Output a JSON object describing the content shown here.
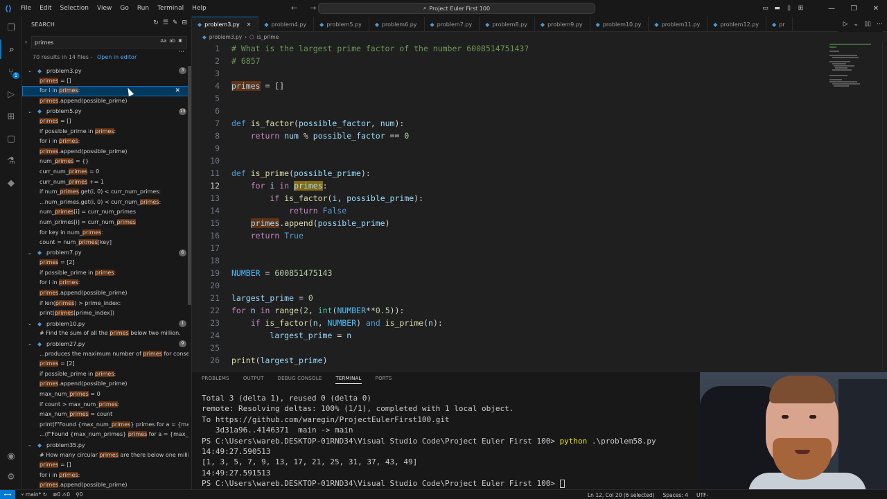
{
  "titlebar": {
    "menu": [
      "File",
      "Edit",
      "Selection",
      "View",
      "Go",
      "Run",
      "Terminal",
      "Help"
    ],
    "search_text": "Project Euler First 100"
  },
  "sidebar": {
    "header": "SEARCH",
    "search_value": "primes",
    "opt_case": "Aa",
    "opt_word": "ab",
    "summary": "70 results in 14 files -",
    "open_in_editor": "Open in editor",
    "results": [
      {
        "type": "file",
        "name": "problem3.py",
        "count": "3"
      },
      {
        "type": "line",
        "pre": "",
        "hl": "primes",
        "post": " = []"
      },
      {
        "type": "line",
        "pre": "for i in ",
        "hl": "primes",
        "post": ":",
        "selected": true
      },
      {
        "type": "line",
        "pre": "",
        "hl": "primes",
        "post": ".append(possible_prime)"
      },
      {
        "type": "file",
        "name": "problem5.py",
        "count": "13"
      },
      {
        "type": "line",
        "pre": "",
        "hl": "primes",
        "post": " = []"
      },
      {
        "type": "line",
        "pre": "if possible_prime in ",
        "hl": "primes",
        "post": ":"
      },
      {
        "type": "line",
        "pre": "for i in ",
        "hl": "primes",
        "post": ":"
      },
      {
        "type": "line",
        "pre": "",
        "hl": "primes",
        "post": ".append(possible_prime)"
      },
      {
        "type": "line",
        "pre": "num_",
        "hl": "primes",
        "post": " = {}"
      },
      {
        "type": "line",
        "pre": "curr_num_",
        "hl": "primes",
        "post": " = 0"
      },
      {
        "type": "line",
        "pre": "curr_num_",
        "hl": "primes",
        "post": " += 1"
      },
      {
        "type": "line",
        "pre": "if num_",
        "hl": "primes",
        "post": ".get(i, 0) < curr_num_primes:"
      },
      {
        "type": "line",
        "pre": "...num_primes.get(i, 0) < curr_num_",
        "hl": "primes",
        "post": ":"
      },
      {
        "type": "line",
        "pre": "num_",
        "hl": "primes",
        "post": "[i] = curr_num_primes"
      },
      {
        "type": "line",
        "pre": "num_primes[i] = curr_num_",
        "hl": "primes",
        "post": ""
      },
      {
        "type": "line",
        "pre": "for key in num_",
        "hl": "primes",
        "post": ":"
      },
      {
        "type": "line",
        "pre": "count = num_",
        "hl": "primes",
        "post": "[key]"
      },
      {
        "type": "file",
        "name": "problem7.py",
        "count": "6"
      },
      {
        "type": "line",
        "pre": "",
        "hl": "primes",
        "post": " = [2]"
      },
      {
        "type": "line",
        "pre": "if possible_prime in ",
        "hl": "primes",
        "post": ":"
      },
      {
        "type": "line",
        "pre": "for i in ",
        "hl": "primes",
        "post": ":"
      },
      {
        "type": "line",
        "pre": "",
        "hl": "primes",
        "post": ".append(possible_prime)"
      },
      {
        "type": "line",
        "pre": "if len(",
        "hl": "primes",
        "post": ") > prime_index:"
      },
      {
        "type": "line",
        "pre": "print(",
        "hl": "primes",
        "post": "[prime_index])"
      },
      {
        "type": "file",
        "name": "problem10.py",
        "count": "1"
      },
      {
        "type": "line",
        "pre": "# Find the sum of all the ",
        "hl": "primes",
        "post": " below two million."
      },
      {
        "type": "file",
        "name": "problem27.py",
        "count": "9"
      },
      {
        "type": "line",
        "pre": "...produces the maximum number of ",
        "hl": "primes",
        "post": " for consec..."
      },
      {
        "type": "line",
        "pre": "",
        "hl": "primes",
        "post": " = [2]"
      },
      {
        "type": "line",
        "pre": "if possible_prime in ",
        "hl": "primes",
        "post": ":"
      },
      {
        "type": "line",
        "pre": "",
        "hl": "primes",
        "post": ".append(possible_prime)"
      },
      {
        "type": "line",
        "pre": "max_num_",
        "hl": "primes",
        "post": " = 0"
      },
      {
        "type": "line",
        "pre": "if count > max_num_",
        "hl": "primes",
        "post": ":"
      },
      {
        "type": "line",
        "pre": "max_num_",
        "hl": "primes",
        "post": " = count"
      },
      {
        "type": "line",
        "pre": "print(f\"Found {max_num_",
        "hl": "primes",
        "post": "} primes for a = {max_a..."
      },
      {
        "type": "line",
        "pre": "...(f\"Found {max_num_primes} ",
        "hl": "primes",
        "post": " for a = {max_a_b[..."
      },
      {
        "type": "file",
        "name": "problem35.py",
        "count": ""
      },
      {
        "type": "line",
        "pre": "# How many circular ",
        "hl": "primes",
        "post": " are there below one million?"
      },
      {
        "type": "line",
        "pre": "",
        "hl": "primes",
        "post": " = []"
      },
      {
        "type": "line",
        "pre": "for i in ",
        "hl": "primes",
        "post": ":"
      },
      {
        "type": "line",
        "pre": "",
        "hl": "primes",
        "post": ".append(possible_prime)"
      }
    ]
  },
  "editor": {
    "tabs": [
      "problem3.py",
      "problem4.py",
      "problem5.py",
      "problem6.py",
      "problem7.py",
      "problem8.py",
      "problem9.py",
      "problem10.py",
      "problem11.py",
      "problem12.py",
      "pr"
    ],
    "active_tab": "problem3.py",
    "breadcrumb_file": "problem3.py",
    "breadcrumb_symbol": "is_prime",
    "current_line": "12"
  },
  "panel": {
    "tabs": [
      "PROBLEMS",
      "OUTPUT",
      "DEBUG CONSOLE",
      "TERMINAL",
      "PORTS"
    ],
    "active_tab": "TERMINAL",
    "terminal": [
      "Total 3 (delta 1), reused 0 (delta 0)",
      "remote: Resolving deltas: 100% (1/1), completed with 1 local object.",
      "To https://github.com/waregin/ProjectEulerFirst100.git",
      "   3d31a96..4146371  main -> main",
      "14:49:27.590513",
      "[1, 3, 5, 7, 9, 13, 17, 21, 25, 31, 37, 43, 49]",
      "14:49:27.591513"
    ],
    "prompt_path": "PS C:\\Users\\wareb.DESKTOP-01RND34\\Visual Studio Code\\Project Euler First 100> ",
    "prompt_cmd": "python",
    "prompt_arg": " .\\problem58.py",
    "final_prompt": "PS C:\\Users\\wareb.DESKTOP-01RND34\\Visual Studio Code\\Project Euler First 100> "
  },
  "statusbar": {
    "branch": "main*",
    "errors": "0",
    "warnings": "0",
    "ports": "0",
    "position": "Ln 12, Col 20 (6 selected)",
    "spaces": "Spaces: 4",
    "encoding": "UTF-"
  },
  "colors": {
    "accent": "#0078d4",
    "match_highlight": "#ea5c00"
  }
}
